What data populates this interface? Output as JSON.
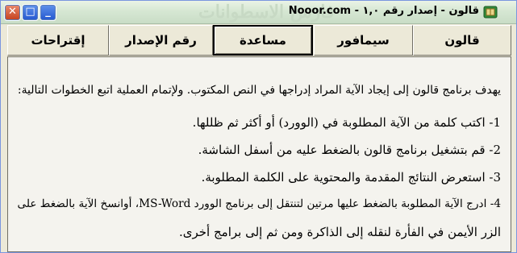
{
  "window": {
    "title": "قالون - إصدار رقم ١,٠",
    "site": "Nooor.com -",
    "watermark": "فارس الاسطوانات",
    "controls": {
      "minimize": "_",
      "maximize": "□",
      "close": "✕"
    }
  },
  "menu": {
    "items": [
      {
        "label": "قالون"
      },
      {
        "label": "سيمافور"
      },
      {
        "label": "مساعدة",
        "active": true
      },
      {
        "label": "رقم الإصدار"
      },
      {
        "label": "إقتراحات"
      }
    ]
  },
  "content": {
    "lines": [
      "يهدف برنامج قالون إلى إيجاد الآية المراد إدراجها في النص المكتوب. ولإتمام العملية اتبع الخطوات التالية:",
      "1- اكتب كلمة من الآية المطلوبة في (الوورد) أو أكثر ثم ظللها.",
      "2- قم بتشغيل برنامج قالون بالضغط عليه من أسفل الشاشة.",
      "3- استعرض النتائج المقدمة والمحتوية على الكلمة المطلوبة.",
      "4- ادرج الآية المطلوبة بالضغط عليها مرتين لتنتقل إلى برنامج الوورد MS-Word، أوانسخ الآية بالضغط على",
      "الزر الأيمن في الفأرة لنقله إلى الذاكرة ومن ثم إلى برامج أخرى."
    ]
  }
}
